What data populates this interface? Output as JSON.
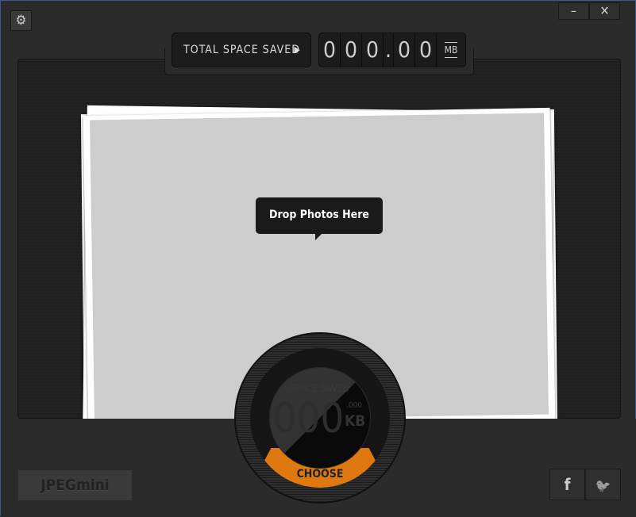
{
  "header": {
    "total_label": "TOTAL SPACE SAVED",
    "arrow": "▶",
    "digits": [
      "0",
      "0",
      "0",
      ".",
      "0",
      "0"
    ],
    "unit": "MB"
  },
  "window": {
    "minimize": "–",
    "close": "✕",
    "settings": "⚙"
  },
  "dropzone": {
    "tooltip": "Drop Photos Here"
  },
  "dial": {
    "label": "SPACE SAVED",
    "value": "000",
    "fraction": ".000",
    "unit": "KB",
    "button": "CHOOSE",
    "accent": "#e07810"
  },
  "footer": {
    "logo": "JPEGmini",
    "facebook": "f",
    "twitter": "🐦"
  }
}
